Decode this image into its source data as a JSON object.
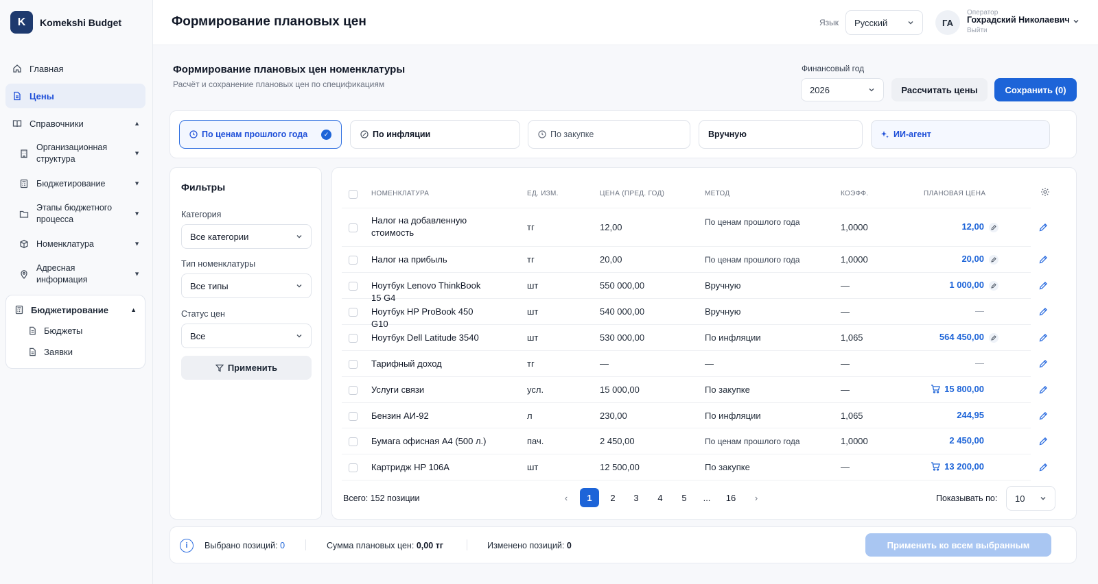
{
  "app": {
    "logo_letter": "K",
    "name": "Komekshi Budget"
  },
  "sidebar": {
    "items": [
      {
        "label": "Главная",
        "icon": "home-icon"
      },
      {
        "label": "Цены",
        "icon": "document-icon",
        "active": true
      },
      {
        "label": "Справочники",
        "icon": "book-icon"
      }
    ],
    "sub_items": [
      {
        "label": "Организационная структура",
        "icon": "building-icon"
      },
      {
        "label": "Бюджетирование",
        "icon": "calculator-icon"
      },
      {
        "label": "Этапы бюджетного процесса",
        "icon": "folder-icon"
      },
      {
        "label": "Номенклатура",
        "icon": "box-icon"
      },
      {
        "label": "Адресная информация",
        "icon": "map-pin-icon"
      }
    ],
    "group": {
      "label": "Бюджетирование",
      "children": [
        {
          "label": "Бюджеты"
        },
        {
          "label": "Заявки"
        }
      ]
    }
  },
  "header": {
    "title": "Формирование плановых цен",
    "language_label": "Язык",
    "language_value": "Русский",
    "user": {
      "initials": "ГА",
      "role": "Оператор",
      "name": "Гохрадский Николаевич",
      "logout": "Выйти"
    }
  },
  "section": {
    "title": "Формирование плановых цен номенклатуры",
    "subtitle": "Расчёт и сохранение плановых цен по спецификациям",
    "fiscal_year_label": "Финансовый год",
    "fiscal_year_value": "2026",
    "calc_button": "Рассчитать цены",
    "save_button": "Сохранить (0)"
  },
  "methods": [
    {
      "label": "По ценам прошлого года",
      "active": true
    },
    {
      "label": "По инфляции"
    },
    {
      "label": "По закупке"
    },
    {
      "label": "Вручную"
    },
    {
      "label": "ИИ-агент"
    }
  ],
  "filters": {
    "title": "Фильтры",
    "category_label": "Категория",
    "category_value": "Все категории",
    "type_label": "Тип номенклатуры",
    "type_value": "Все типы",
    "status_label": "Статус цен",
    "status_value": "Все",
    "apply_button": "Применить"
  },
  "table": {
    "columns": [
      "Номенклатура",
      "Ед. изм.",
      "Цена (пред. год)",
      "Метод",
      "Коэфф.",
      "Плановая цена"
    ],
    "rows": [
      {
        "name": "Налог на добавленную стоимость",
        "unit": "тг",
        "prev": "12,00",
        "method": "По ценам прошлого года",
        "coef": "1,0000",
        "plan": "12,00",
        "plan_icon": "pencil"
      },
      {
        "name": "Налог на прибыль",
        "unit": "тг",
        "prev": "20,00",
        "method": "По ценам прошлого года",
        "coef": "1,0000",
        "plan": "20,00",
        "plan_icon": "pencil"
      },
      {
        "name": "Ноутбук Lenovo ThinkBook 15 G4",
        "unit": "шт",
        "prev": "550 000,00",
        "method": "Вручную",
        "coef": "—",
        "plan": "1 000,00",
        "plan_icon": "pencil"
      },
      {
        "name": "Ноутбук HP ProBook 450 G10",
        "unit": "шт",
        "prev": "540 000,00",
        "method": "Вручную",
        "coef": "—",
        "plan": "—",
        "plan_icon": ""
      },
      {
        "name": "Ноутбук Dell Latitude 3540",
        "unit": "шт",
        "prev": "530 000,00",
        "method": "По инфляции",
        "coef": "1,065",
        "plan": "564 450,00",
        "plan_icon": "pencil"
      },
      {
        "name": "Тарифный доход",
        "unit": "тг",
        "prev": "—",
        "method": "—",
        "coef": "—",
        "plan": "—",
        "plan_icon": ""
      },
      {
        "name": "Услуги связи",
        "unit": "усл.",
        "prev": "15 000,00",
        "method": "По закупке",
        "coef": "—",
        "plan": "15 800,00",
        "plan_icon": "cart"
      },
      {
        "name": "Бензин АИ-92",
        "unit": "л",
        "prev": "230,00",
        "method": "По инфляции",
        "coef": "1,065",
        "plan": "244,95",
        "plan_icon": ""
      },
      {
        "name": "Бумага офисная А4 (500 л.)",
        "unit": "пач.",
        "prev": "2 450,00",
        "method": "По ценам прошлого года",
        "coef": "1,0000",
        "plan": "2 450,00",
        "plan_icon": ""
      },
      {
        "name": "Картридж HP 106A",
        "unit": "шт",
        "prev": "12 500,00",
        "method": "По закупке",
        "coef": "—",
        "plan": "13 200,00",
        "plan_icon": "cart"
      }
    ]
  },
  "pagination": {
    "total": "Всего: 152 позиции",
    "pages": [
      "1",
      "2",
      "3",
      "4",
      "5",
      "...",
      "16"
    ],
    "current": "1",
    "per_page_label": "Показывать по:",
    "per_page_value": "10"
  },
  "bottom": {
    "selected_label": "Выбрано позиций:",
    "selected_value": "0",
    "sum_label": "Сумма плановых цен:",
    "sum_value": "0,00 тг",
    "changed_label": "Изменено позиций:",
    "changed_value": "0",
    "apply_all_button": "Применить ко всем выбранным"
  },
  "colors": {
    "accent": "#1d64d8",
    "sidebar_bg": "#f8f9fb",
    "active_bg": "#e9eef8"
  }
}
